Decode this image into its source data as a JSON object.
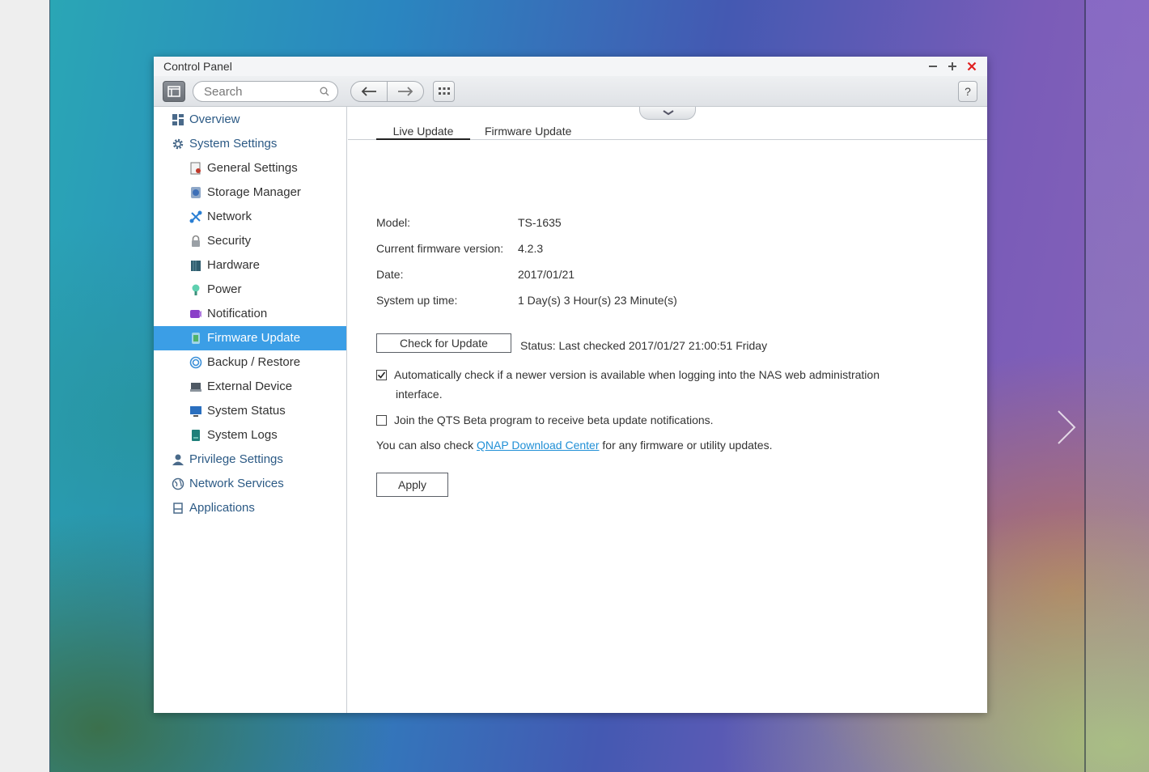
{
  "window": {
    "title": "Control Panel"
  },
  "toolbar": {
    "search_placeholder": "Search",
    "help_label": "?"
  },
  "sidebar": {
    "items": [
      {
        "label": "Overview",
        "level": "top",
        "icon": "overview-icon"
      },
      {
        "label": "System Settings",
        "level": "top",
        "icon": "gear-icon"
      },
      {
        "label": "General Settings",
        "level": "sub",
        "icon": "general-settings-icon"
      },
      {
        "label": "Storage Manager",
        "level": "sub",
        "icon": "storage-icon"
      },
      {
        "label": "Network",
        "level": "sub",
        "icon": "network-icon"
      },
      {
        "label": "Security",
        "level": "sub",
        "icon": "lock-icon"
      },
      {
        "label": "Hardware",
        "level": "sub",
        "icon": "hardware-icon"
      },
      {
        "label": "Power",
        "level": "sub",
        "icon": "bulb-icon"
      },
      {
        "label": "Notification",
        "level": "sub",
        "icon": "notification-icon"
      },
      {
        "label": "Firmware Update",
        "level": "sub",
        "icon": "firmware-icon",
        "active": true
      },
      {
        "label": "Backup / Restore",
        "level": "sub",
        "icon": "backup-icon"
      },
      {
        "label": "External Device",
        "level": "sub",
        "icon": "external-device-icon"
      },
      {
        "label": "System Status",
        "level": "sub",
        "icon": "monitor-icon"
      },
      {
        "label": "System Logs",
        "level": "sub",
        "icon": "logs-icon"
      },
      {
        "label": "Privilege Settings",
        "level": "top",
        "icon": "user-icon"
      },
      {
        "label": "Network Services",
        "level": "top",
        "icon": "globe-icon"
      },
      {
        "label": "Applications",
        "level": "top",
        "icon": "applications-icon"
      }
    ]
  },
  "tabs": [
    {
      "label": "Live Update",
      "active": true
    },
    {
      "label": "Firmware Update",
      "active": false
    }
  ],
  "info": {
    "model_label": "Model:",
    "model_value": "TS-1635",
    "firmware_label": "Current firmware version:",
    "firmware_value": "4.2.3",
    "date_label": "Date:",
    "date_value": "2017/01/21",
    "uptime_label": "System up time:",
    "uptime_value": "1 Day(s) 3 Hour(s) 23 Minute(s)"
  },
  "update": {
    "check_button": "Check for Update",
    "status": "Status: Last checked 2017/01/27 21:00:51 Friday",
    "auto_check_label_line1": "Automatically check if a newer version is available when logging into the NAS web administration",
    "auto_check_label_line2": "interface.",
    "auto_check_checked": true,
    "beta_label": "Join the QTS Beta program to receive beta update notifications.",
    "beta_checked": false,
    "download_prefix": "You can also check ",
    "download_link": "QNAP Download Center",
    "download_suffix": " for any firmware or utility updates.",
    "apply_button": "Apply"
  },
  "colors": {
    "accent": "#3b9ee6",
    "nav_text": "#2c5a85",
    "link": "#1f8fd6",
    "close": "#e02020"
  }
}
